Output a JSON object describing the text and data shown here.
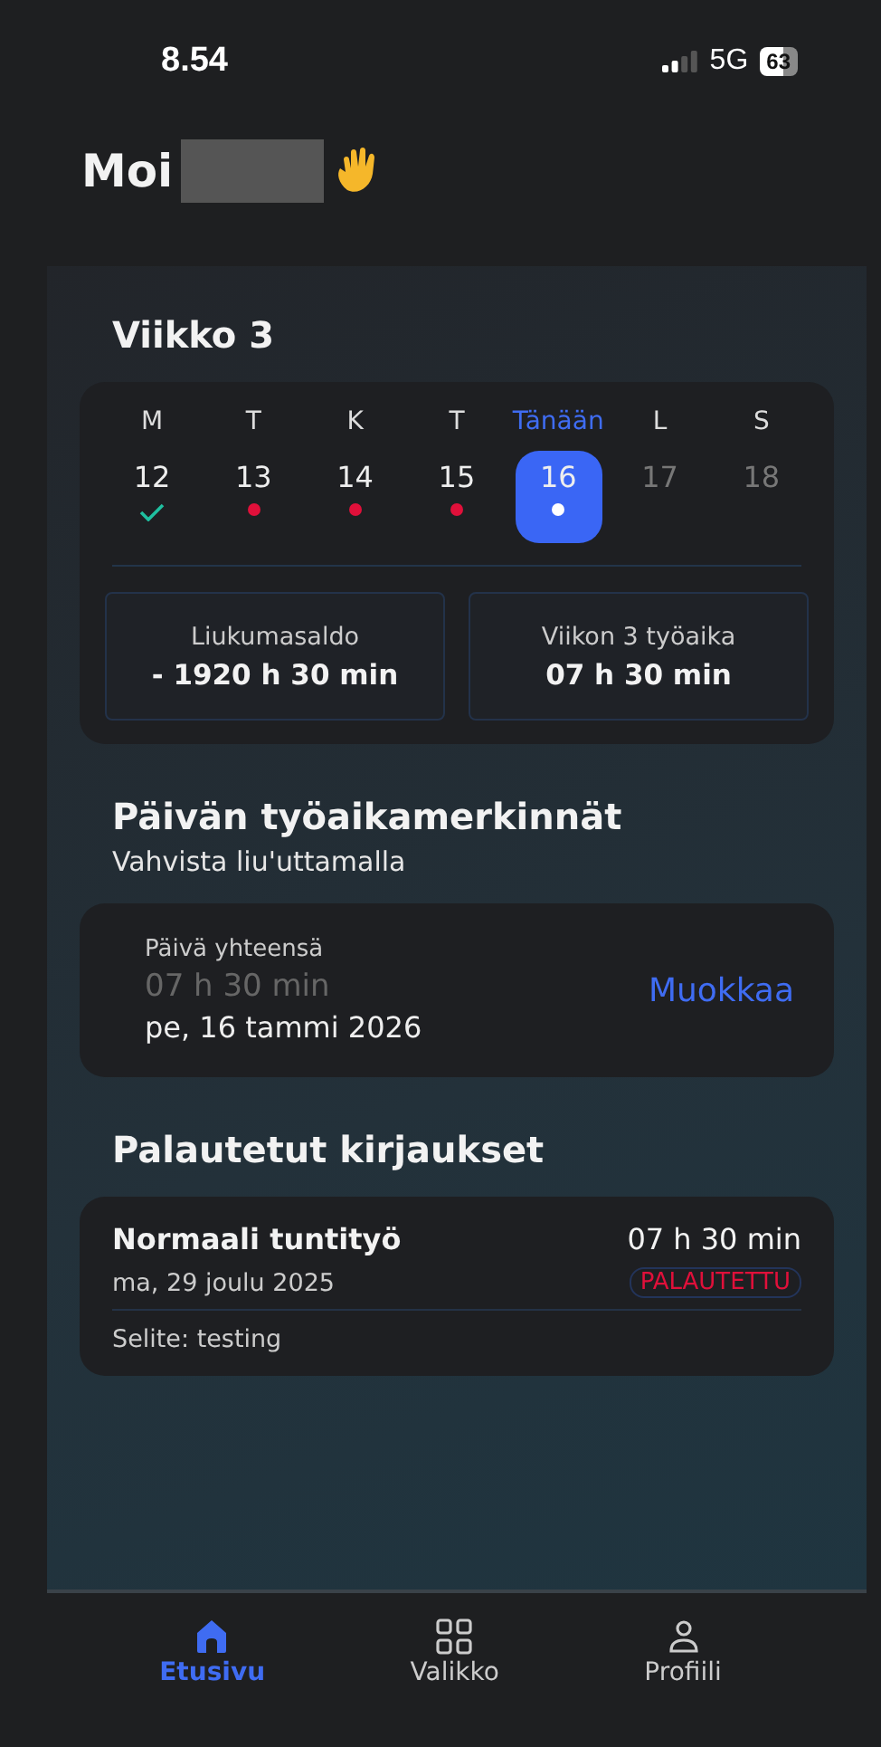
{
  "status_bar": {
    "time": "8.54",
    "network": "5G",
    "battery": "63"
  },
  "greeting": {
    "text": "Moi"
  },
  "week": {
    "title": "Viikko 3",
    "days": [
      {
        "label": "M",
        "number": "12",
        "kind": "confirmed",
        "selected": false,
        "future": false
      },
      {
        "label": "T",
        "number": "13",
        "kind": "pending",
        "selected": false,
        "future": false
      },
      {
        "label": "K",
        "number": "14",
        "kind": "pending",
        "selected": false,
        "future": false
      },
      {
        "label": "T",
        "number": "15",
        "kind": "pending",
        "selected": false,
        "future": false
      },
      {
        "label": "Tänään",
        "number": "16",
        "kind": "pending",
        "selected": true,
        "future": false
      },
      {
        "label": "L",
        "number": "17",
        "kind": "empty",
        "selected": false,
        "future": true
      },
      {
        "label": "S",
        "number": "18",
        "kind": "empty",
        "selected": false,
        "future": true
      }
    ],
    "summaries": [
      {
        "label": "Liukumasaldo",
        "value": "- 1920 h 30 min"
      },
      {
        "label": "Viikon 3 työaika",
        "value": "07 h 30 min"
      }
    ]
  },
  "day_entries": {
    "title": "Päivän työaikamerkinnät",
    "subtitle": "Vahvista liu'uttamalla",
    "card": {
      "label": "Päivä yhteensä",
      "total": "07 h 30 min",
      "date": "pe, 16 tammi 2026",
      "action": "Muokkaa"
    }
  },
  "returned": {
    "title": "Palautetut kirjaukset",
    "entries": [
      {
        "title": "Normaali tuntityö",
        "duration": "07 h 30 min",
        "date": "ma, 29 joulu 2025",
        "status": "PALAUTETTU",
        "note": "Selite: testing"
      }
    ]
  },
  "nav": [
    {
      "label": "Etusivu",
      "selected": true
    },
    {
      "label": "Valikko",
      "selected": false
    },
    {
      "label": "Profiili",
      "selected": false
    }
  ]
}
